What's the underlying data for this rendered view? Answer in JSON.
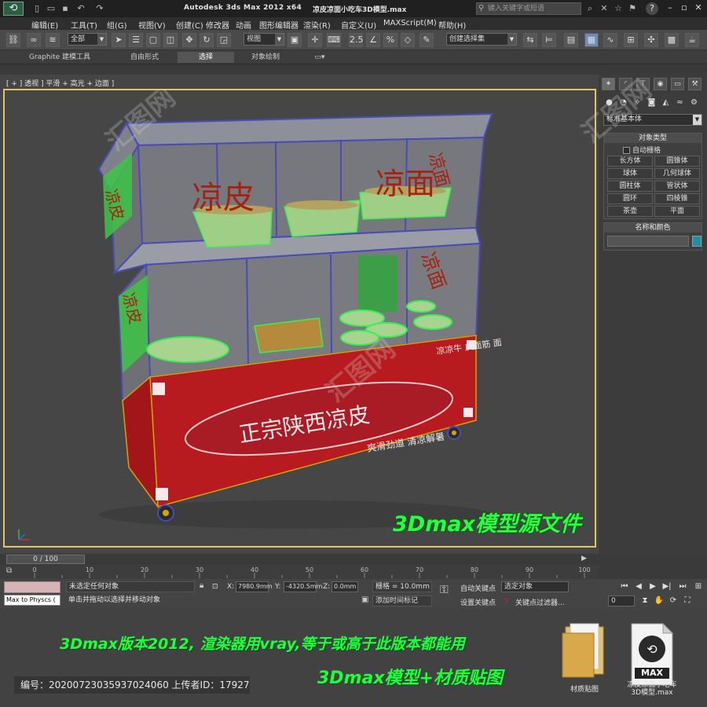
{
  "titlebar": {
    "app_title": "Autodesk 3ds Max  2012 x64",
    "file_title": "凉皮凉面小吃车3D模型.max",
    "search_placeholder": "键入关键字或短语",
    "help": "?",
    "quick_access_icons": [
      "new-icon",
      "open-icon",
      "save-icon",
      "undo-icon",
      "redo-icon"
    ]
  },
  "menu": [
    "编辑(E)",
    "工具(T)",
    "组(G)",
    "视图(V)",
    "创建(C)",
    "修改器",
    "动画",
    "图形编辑器",
    "渲染(R)",
    "自定义(U)",
    "MAXScript(M)",
    "帮助(H)"
  ],
  "toolbar": {
    "selection_filter": "全部",
    "ref_coord": "视图",
    "snap_value": "2.5",
    "named_selection": "创建选择集"
  },
  "ribbon": {
    "tabs": [
      "Graphite 建模工具",
      "自由形式",
      "选择",
      "对象绘制"
    ],
    "active_tab": "选择"
  },
  "viewport": {
    "label": "[ + ] 透视 ] 平滑 + 高光 + 边面 ]",
    "caption": "3Dmax模型源文件",
    "scene_text": {
      "top_left": "凉皮",
      "top_right": "凉面",
      "side_top": "凉皮",
      "side_top_right": "凉面",
      "side_mid": "凉面",
      "side_left": "凉皮",
      "banner": "正宗陕西凉皮",
      "slogan": "爽滑劲道  清凉解暑",
      "menu_right": "凉凉牛\n皮面筋\n面"
    }
  },
  "command_panel": {
    "tab_icons": [
      "create-icon",
      "modify-icon",
      "hierarchy-icon",
      "motion-icon",
      "display-icon",
      "utilities-icon"
    ],
    "category_icons": [
      "geometry-icon",
      "shapes-icon",
      "lights-icon",
      "cameras-icon",
      "helpers-icon",
      "spacewarps-icon",
      "systems-icon"
    ],
    "dropdown": "标准基本体",
    "object_type": {
      "title": "对象类型",
      "autogrid": "自动栅格",
      "buttons": [
        "长方体",
        "圆锥体",
        "球体",
        "几何球体",
        "圆柱体",
        "管状体",
        "圆环",
        "四棱锥",
        "茶壶",
        "平面"
      ]
    },
    "name_color": {
      "title": "名称和颜色",
      "swatch": "#1f8fa8"
    }
  },
  "timeline": {
    "slider": "0 / 100",
    "ticks": [
      "0",
      "10",
      "20",
      "30",
      "40",
      "50",
      "60",
      "70",
      "80",
      "90",
      "100"
    ]
  },
  "status": {
    "maxscript": "Max to Physcs (",
    "selection": "未选定任何对象",
    "prompt": "单击并拖动以选择并移动对象",
    "x_label": "X:",
    "x": "7980.9mm",
    "y_label": "Y:",
    "y": "-4320.5mm",
    "z_label": "Z:",
    "z": "0.0mm",
    "grid": "栅格 = 10.0mm",
    "timetag": "添加时间标记",
    "auto_key": "自动关键点",
    "set_key": "设置关键点",
    "key_combo": "选定对象",
    "key_filters": "关键点过滤器...",
    "frame": "0"
  },
  "promo": {
    "line1": "3Dmax版本2012, 渲染器用vray,等于或高于此版本都能用",
    "line2": "3Dmax模型+材质贴图",
    "id_label": "编号：",
    "id_value": "20200723035937024060",
    "uploader_label": "上传者ID：",
    "uploader_value": "17927",
    "folder_caption": "材质贴图",
    "max_badge": "MAX",
    "max_caption": "凉皮凉面小吃车\n3D模型.max"
  },
  "watermark": "汇图网"
}
